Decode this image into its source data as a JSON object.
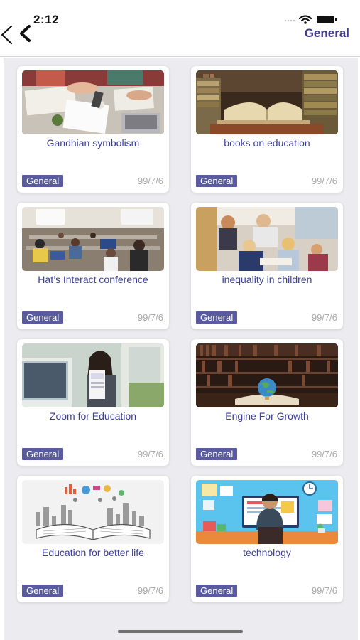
{
  "status_bar": {
    "time": "2:12"
  },
  "header": {
    "title": "General"
  },
  "cards": [
    {
      "title": "Gandhian symbolism",
      "category": "General",
      "date": "99/7/6",
      "image": "students-studying-photo"
    },
    {
      "title": "books on education",
      "category": "General",
      "date": "99/7/6",
      "image": "stacked-books-photo"
    },
    {
      "title": "Hat’s Interact conference",
      "category": "General",
      "date": "99/7/6",
      "image": "conference-room-photo"
    },
    {
      "title": "inequality in children",
      "category": "General",
      "date": "99/7/6",
      "image": "children-classroom-photo"
    },
    {
      "title": "Zoom for Education",
      "category": "General",
      "date": "99/7/6",
      "image": "woman-video-call-photo"
    },
    {
      "title": "Engine For Growth",
      "category": "General",
      "date": "99/7/6",
      "image": "library-globe-photo"
    },
    {
      "title": "Education for better life",
      "category": "General",
      "date": "99/7/6",
      "image": "open-book-city-illustration"
    },
    {
      "title": "technology",
      "category": "General",
      "date": "99/7/6",
      "image": "desk-computer-illustration"
    }
  ],
  "colors": {
    "accent": "#3f3a8f",
    "badge": "#5a5a9e",
    "background": "#ebebf0"
  }
}
